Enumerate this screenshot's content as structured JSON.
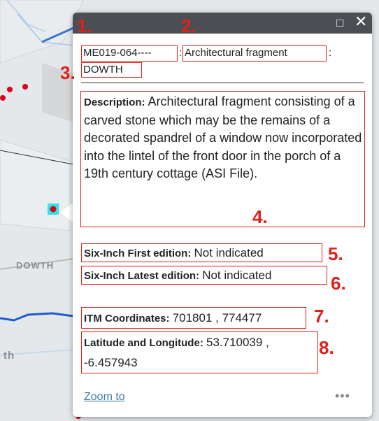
{
  "map": {
    "place_label_1": "DOWTH",
    "place_label_2": "th"
  },
  "popup": {
    "id": "ME019-064----",
    "sep1": ":",
    "classification": "Architectural fragment",
    "sep2": ":",
    "townland": "DOWTH",
    "description_label": "Description:",
    "description_text": "Architectural fragment consisting of a carved stone which may be the remains of a decorated spandrel of a window now incorporated into the lintel of the front door in the porch of a 19th century cottage (ASI File).",
    "first_edition_label": "Six-Inch First edition:",
    "first_edition_value": "Not indicated",
    "latest_edition_label": "Six-Inch Latest edition:",
    "latest_edition_value": "Not indicated",
    "itm_label": "ITM Coordinates:",
    "itm_value": "701801 , 774477",
    "latlon_label": "Latitude and Longitude:",
    "latlon_value_line1": "53.710039 ,",
    "latlon_value_line2": "-6.457943",
    "zoom_label": "Zoom to",
    "more_label": "•••",
    "maximize_icon": "maximize-icon",
    "close_icon": "close-icon"
  },
  "annotations": {
    "n1": "1.",
    "n2": "2.",
    "n3": "3.",
    "n4": "4.",
    "n5": "5.",
    "n6": "6.",
    "n7": "7.",
    "n8": "8.",
    "color": "#e0201a"
  }
}
